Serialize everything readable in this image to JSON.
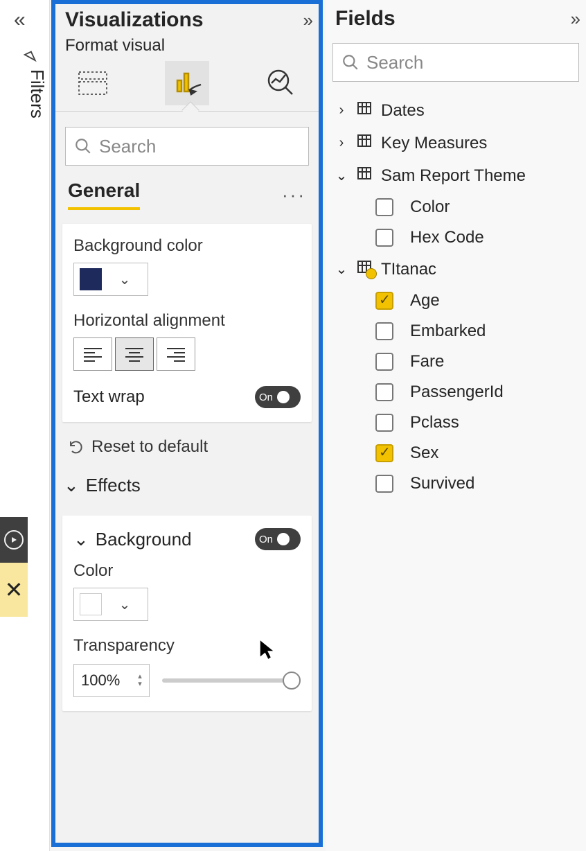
{
  "left_rail": {
    "filters_label": "Filters"
  },
  "viz": {
    "title": "Visualizations",
    "subhead": "Format visual",
    "search_placeholder": "Search",
    "tab_general": "General",
    "bg_color_label": "Background color",
    "bg_color_value": "#1f2a5c",
    "halign_label": "Horizontal alignment",
    "textwrap_label": "Text wrap",
    "textwrap_state": "On",
    "reset_label": "Reset to default",
    "effects_label": "Effects",
    "background_label": "Background",
    "background_state": "On",
    "color_label": "Color",
    "color_value": "#ffffff",
    "transparency_label": "Transparency",
    "transparency_value": "100%"
  },
  "fields": {
    "title": "Fields",
    "search_placeholder": "Search",
    "tables": [
      {
        "name": "Dates",
        "expanded": false
      },
      {
        "name": "Key Measures",
        "expanded": false
      },
      {
        "name": "Sam Report Theme",
        "expanded": true,
        "fields": [
          {
            "name": "Color",
            "checked": false
          },
          {
            "name": "Hex Code",
            "checked": false
          }
        ]
      },
      {
        "name": "TItanac",
        "expanded": true,
        "fields": [
          {
            "name": "Age",
            "checked": true
          },
          {
            "name": "Embarked",
            "checked": false
          },
          {
            "name": "Fare",
            "checked": false
          },
          {
            "name": "PassengerId",
            "checked": false
          },
          {
            "name": "Pclass",
            "checked": false
          },
          {
            "name": "Sex",
            "checked": true
          },
          {
            "name": "Survived",
            "checked": false
          }
        ]
      }
    ]
  }
}
